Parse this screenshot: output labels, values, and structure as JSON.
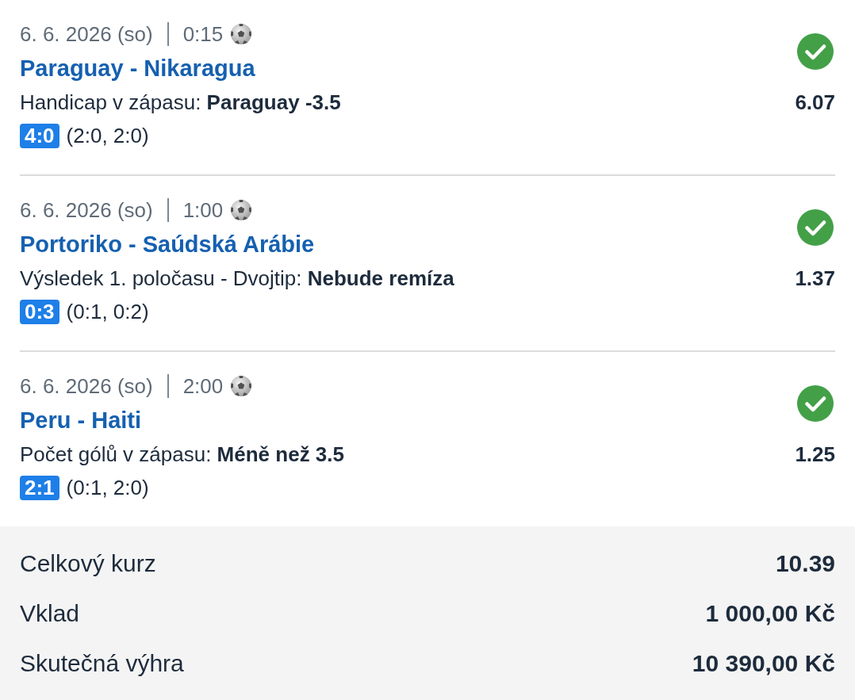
{
  "bets": [
    {
      "date": "6. 6. 2026 (so)",
      "time": "0:15",
      "match": "Paraguay - Nikaragua",
      "market": "Handicap v zápasu: **Paraguay -3.5**",
      "odds": "6.07",
      "won": true,
      "score": "4:0",
      "halves": "(2:0, 2:0)"
    },
    {
      "date": "6. 6. 2026 (so)",
      "time": "1:00",
      "match": "Portoriko - Saúdská Arábie",
      "market": "Výsledek 1. poločasu - Dvojtip: **Nebude remíza**",
      "odds": "1.37",
      "won": true,
      "score": "0:3",
      "halves": "(0:1, 0:2)"
    },
    {
      "date": "6. 6. 2026 (so)",
      "time": "2:00",
      "match": "Peru - Haiti",
      "market": "Počet gólů v zápasu: **Méně než 3.5**",
      "odds": "1.25",
      "won": true,
      "score": "2:1",
      "halves": "(0:1, 2:0)"
    }
  ],
  "summary": [
    {
      "label": "Celkový kurz",
      "value": "10.39"
    },
    {
      "label": "Vklad",
      "value": "1 000,00 Kč"
    },
    {
      "label": "Skutečná výhra",
      "value": "10 390,00 Kč"
    }
  ]
}
